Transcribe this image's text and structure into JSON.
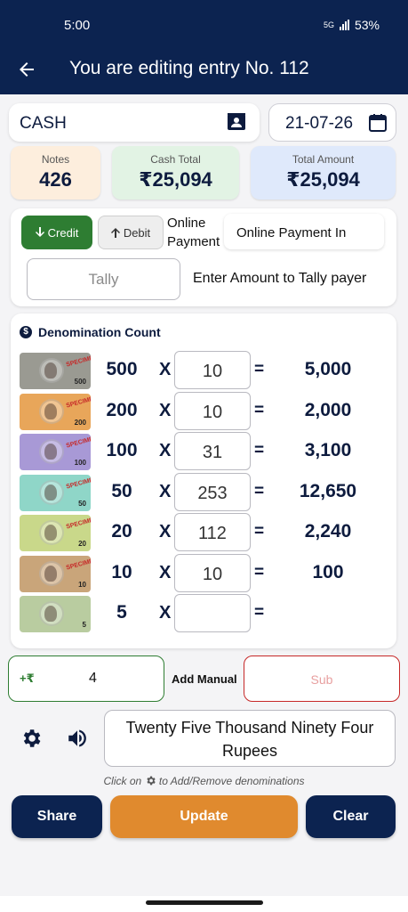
{
  "status": {
    "time": "5:00",
    "battery": "53%",
    "network": "5G"
  },
  "appbar": {
    "title": "You are editing entry No. 112"
  },
  "entry": {
    "account": "CASH",
    "date": "21-07-26"
  },
  "stats": [
    {
      "label": "Notes",
      "value": "426"
    },
    {
      "label": "Cash Total",
      "value": "₹25,094"
    },
    {
      "label": "Total Amount",
      "value": "₹25,094"
    }
  ],
  "mode": {
    "credit_label": "Credit",
    "debit_label": "Debit",
    "online_label": "Online Payment",
    "online_value": "Online Payment In",
    "tally_placeholder": "Tally",
    "tally_hint": "Enter Amount to Tally payer"
  },
  "denominations": {
    "title": "Denomination Count",
    "rows": [
      {
        "denom": "500",
        "qty": "10",
        "result": "5,000",
        "note_color": "#9a9a92"
      },
      {
        "denom": "200",
        "qty": "10",
        "result": "2,000",
        "note_color": "#e8a65a"
      },
      {
        "denom": "100",
        "qty": "31",
        "result": "3,100",
        "note_color": "#a899d6"
      },
      {
        "denom": "50",
        "qty": "253",
        "result": "12,650",
        "note_color": "#8fd6c8"
      },
      {
        "denom": "20",
        "qty": "112",
        "result": "2,240",
        "note_color": "#c9d88a"
      },
      {
        "denom": "10",
        "qty": "10",
        "result": "100",
        "note_color": "#c9a57a"
      },
      {
        "denom": "5",
        "qty": "",
        "result": "",
        "note_color": "#b9cca0"
      }
    ]
  },
  "manual": {
    "prefix": "+₹",
    "value": "4",
    "add_label": "Add Manual",
    "sub_label": "Sub"
  },
  "words": "Twenty Five  Thousand Ninety Four Rupees",
  "hint": {
    "before": "Click on",
    "after": "to Add/Remove denominations"
  },
  "actions": {
    "share": "Share",
    "update": "Update",
    "clear": "Clear"
  },
  "colors": {
    "primary": "#0c2350",
    "accent": "#e08a2e",
    "credit": "#2e7d32",
    "sub": "#c62828"
  }
}
